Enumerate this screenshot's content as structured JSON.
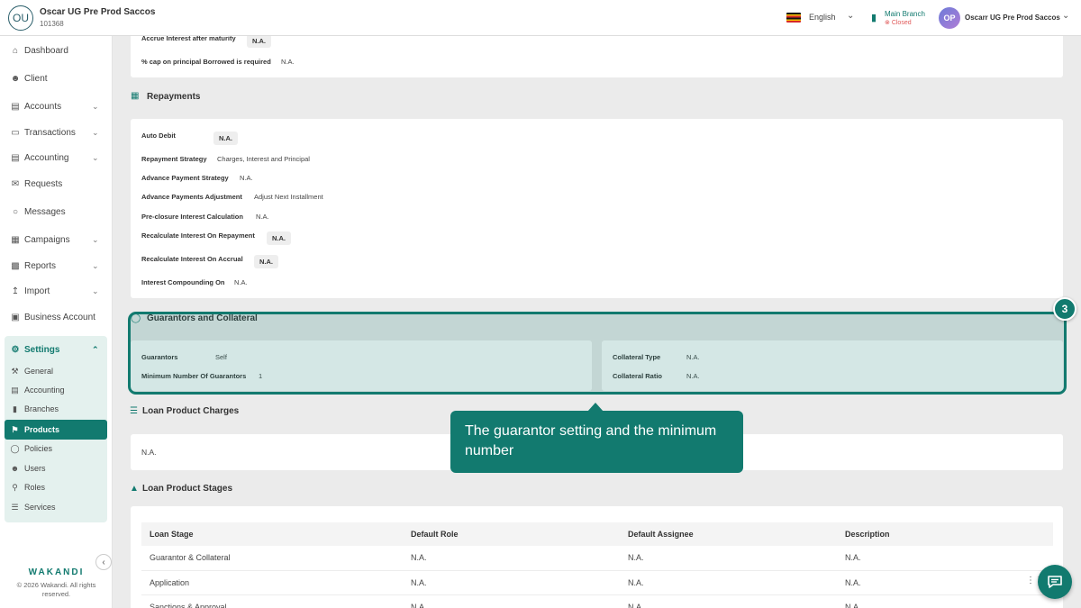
{
  "header": {
    "org_initials": "OU",
    "org_name": "Oscar UG Pre Prod Saccos",
    "org_code": "101368",
    "language": "English",
    "branch_name": "Main Branch",
    "branch_status": "Closed",
    "user_initials": "OP",
    "user_name": "Oscarr UG Pre Prod Saccos"
  },
  "sidebar": {
    "items": [
      {
        "label": "Dashboard",
        "icon": "home-icon"
      },
      {
        "label": "Client",
        "icon": "users-icon"
      },
      {
        "label": "Accounts",
        "icon": "wallet-icon"
      },
      {
        "label": "Transactions",
        "icon": "card-icon"
      },
      {
        "label": "Accounting",
        "icon": "ledger-icon"
      },
      {
        "label": "Requests",
        "icon": "mail-icon"
      },
      {
        "label": "Messages",
        "icon": "chat-icon"
      },
      {
        "label": "Campaigns",
        "icon": "grid-icon"
      },
      {
        "label": "Reports",
        "icon": "chart-icon"
      },
      {
        "label": "Import",
        "icon": "upload-icon"
      },
      {
        "label": "Business Account",
        "icon": "briefcase-icon"
      }
    ],
    "settings_label": "Settings",
    "settings_sub": [
      {
        "label": "General"
      },
      {
        "label": "Accounting"
      },
      {
        "label": "Branches"
      },
      {
        "label": "Products"
      },
      {
        "label": "Policies"
      },
      {
        "label": "Users"
      },
      {
        "label": "Roles"
      },
      {
        "label": "Services"
      }
    ],
    "brand": "WAKANDI",
    "copyright": "© 2026 Wakandi. All rights reserved."
  },
  "top_card": {
    "row1_label": "Accrue Interest after maturity",
    "row1_value": "N.A.",
    "row2_label": "% cap on principal Borrowed is required",
    "row2_value": "N.A."
  },
  "repayments": {
    "title": "Repayments",
    "rows": [
      {
        "label": "Auto Debit",
        "value": "N.A."
      },
      {
        "label": "Repayment Strategy",
        "value": "Charges, Interest and Principal"
      },
      {
        "label": "Advance Payment Strategy",
        "value": "N.A."
      },
      {
        "label": "Advance Payments Adjustment",
        "value": "Adjust Next Installment"
      },
      {
        "label": "Pre-closure Interest Calculation",
        "value": "N.A."
      },
      {
        "label": "Recalculate Interest On Repayment",
        "value": "N.A."
      },
      {
        "label": "Recalculate Interest On Accrual",
        "value": "N.A."
      },
      {
        "label": "Interest Compounding On",
        "value": "N.A."
      }
    ]
  },
  "guarantors": {
    "title": "Guarantors and Collateral",
    "guarantors_label": "Guarantors",
    "guarantors_value": "Self",
    "min_label": "Minimum Number Of Guarantors",
    "min_value": "1",
    "collateral_type_label": "Collateral Type",
    "collateral_type_value": "N.A.",
    "collateral_ratio_label": "Collateral Ratio",
    "collateral_ratio_value": "N.A."
  },
  "step_badge": "3",
  "tooltip": "The guarantor setting and the minimum number",
  "charges": {
    "title": "Loan Product Charges",
    "value": "N.A."
  },
  "stages": {
    "title": "Loan Product Stages",
    "columns": [
      "Loan Stage",
      "Default Role",
      "Default Assignee",
      "Description"
    ],
    "rows": [
      [
        "Guarantor & Collateral",
        "N.A.",
        "N.A.",
        "N.A."
      ],
      [
        "Application",
        "N.A.",
        "N.A.",
        "N.A."
      ],
      [
        "Sanctions & Approval",
        "N.A.",
        "N.A.",
        "N.A."
      ]
    ]
  }
}
